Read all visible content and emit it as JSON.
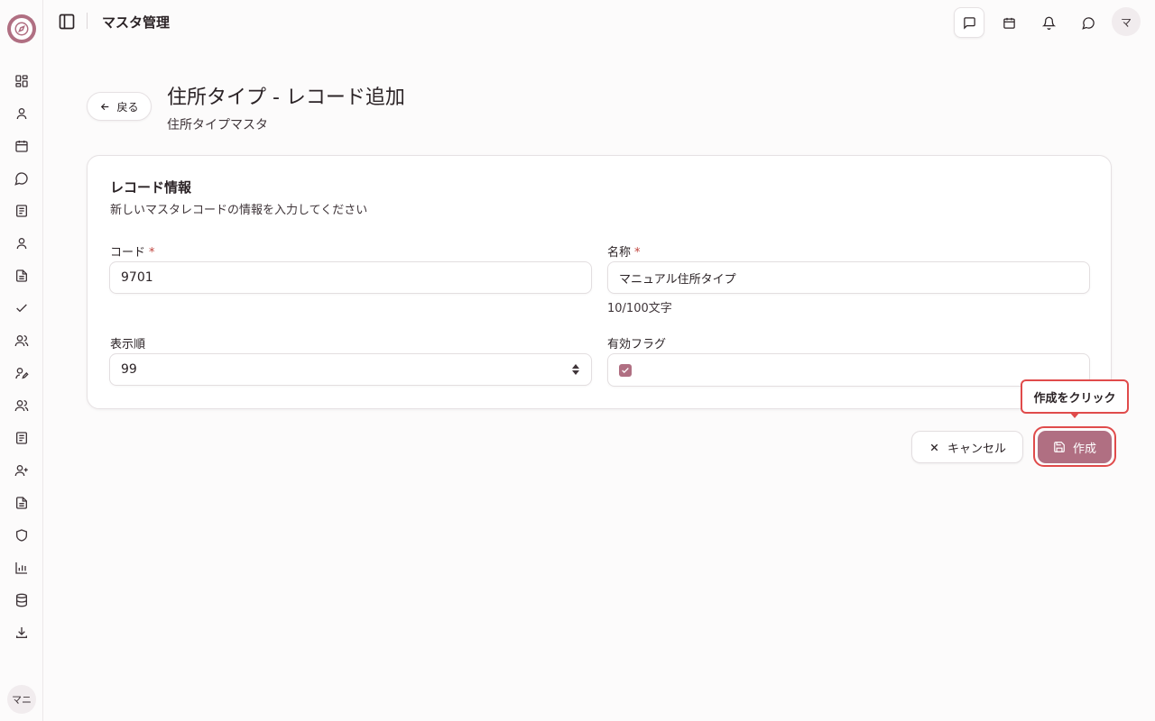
{
  "sidebar": {
    "icons": [
      "dashboard-icon",
      "user-icon",
      "calendar-icon",
      "chat-icon",
      "document-icon",
      "user-icon",
      "file-icon",
      "check-icon",
      "users-icon",
      "user-edit-icon",
      "users-icon",
      "document-icon",
      "user-plus-icon",
      "file-icon",
      "shield-icon",
      "chart-icon",
      "database-icon",
      "download-icon"
    ],
    "user_initials": "マニ"
  },
  "header": {
    "title": "マスタ管理",
    "avatar_initial": "マ"
  },
  "page": {
    "back_label": "戻る",
    "title": "住所タイプ - レコード追加",
    "subtitle": "住所タイプマスタ"
  },
  "card": {
    "title": "レコード情報",
    "description": "新しいマスタレコードの情報を入力してください",
    "fields": {
      "code": {
        "label": "コード",
        "required_mark": "*",
        "value": "9701"
      },
      "name": {
        "label": "名称",
        "required_mark": "*",
        "value": "マニュアル住所タイプ",
        "char_count": "10/100文字"
      },
      "order": {
        "label": "表示順",
        "value": "99"
      },
      "active": {
        "label": "有効フラグ",
        "checked": true
      }
    }
  },
  "actions": {
    "cancel_label": "キャンセル",
    "create_label": "作成",
    "tooltip": "作成をクリック"
  },
  "colors": {
    "accent": "#b06f82",
    "highlight": "#e04b4b"
  }
}
